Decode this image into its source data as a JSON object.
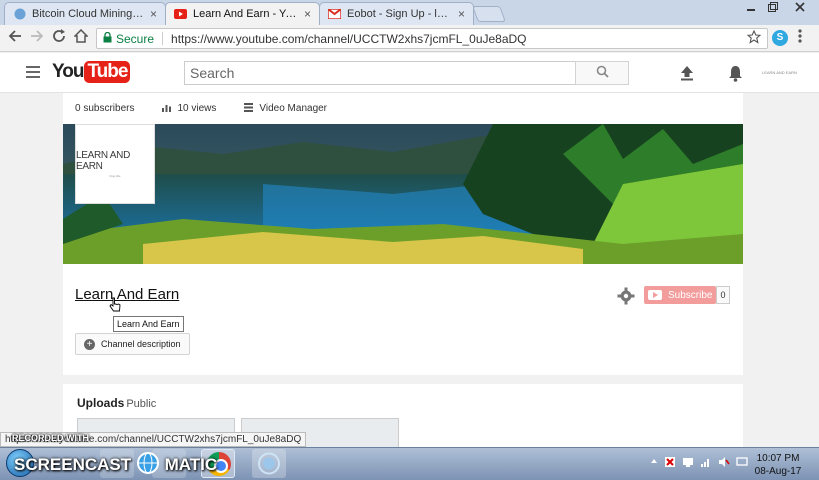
{
  "browser": {
    "tabs": [
      {
        "title": "Bitcoin Cloud Mining and",
        "icon": "bitcoin-icon"
      },
      {
        "title": "Learn And Earn - YouTub",
        "icon": "youtube-icon"
      },
      {
        "title": "Eobot - Sign Up - learna",
        "icon": "gmail-icon"
      }
    ],
    "close_glyph": "×",
    "secure_label": "Secure",
    "url": "https://www.youtube.com/channel/UCCTW2xhs7jcmFL_0uJe8aDQ",
    "extension_label": "S"
  },
  "youtube": {
    "logo_you": "You",
    "logo_tube": "Tube",
    "search_placeholder": "Search",
    "account_label": "LEARN AND EARN"
  },
  "channel": {
    "subscribers": "0 subscribers",
    "views": "10 views",
    "video_manager": "Video Manager",
    "avatar_text": "LEARN AND EARN",
    "avatar_subtext": "blog.title",
    "name": "Learn And Earn",
    "tooltip": "Learn And Earn",
    "description_button": "Channel description",
    "subscribe_label": "Subscribe",
    "subscriber_count": "0",
    "uploads_label": "Uploads",
    "uploads_visibility": "Public"
  },
  "status_bar": {
    "url": "https://www.youtube.com/channel/UCCTW2xhs7jcmFL_0uJe8aDQ",
    "recorded_with": "RECORDED WITH"
  },
  "taskbar": {
    "watermark": "SCREENCAST",
    "watermark_suffix": "MATIC",
    "time": "10:07 PM",
    "date": "08-Aug-17"
  },
  "colors": {
    "accent": "#e62117",
    "subscribe_disabled": "#f39c9c",
    "secure_green": "#0b8043"
  }
}
